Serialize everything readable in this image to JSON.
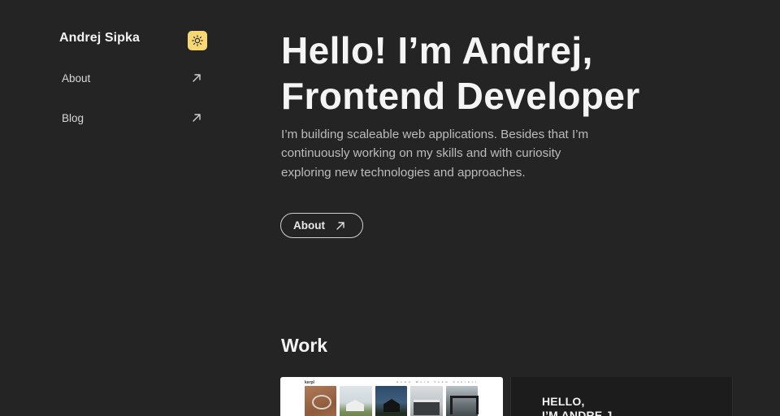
{
  "sidebar": {
    "brand": "Andrej Sipka",
    "nav": [
      {
        "label": "About"
      },
      {
        "label": "Blog"
      }
    ]
  },
  "colors": {
    "background": "#242424",
    "theme_toggle": "#f6d774"
  },
  "icons": {
    "theme_toggle": "sun-icon",
    "nav_link": "arrow-up-right-icon"
  },
  "hero": {
    "title_line1": "Hello! I’m Andrej,",
    "title_line2": "Frontend Developer",
    "description": "I’m building scaleable web applications. Besides that I’m continuously working on my skills and with curiosity exploring new technologies and approaches.",
    "button_label": "About"
  },
  "work": {
    "title": "Work",
    "projects": [
      {
        "logo_text": "kerpl",
        "menu_text": "Home Work Team Contact"
      },
      {
        "text_line1": "HELLO,",
        "text_line2": "I’M ANDRE J"
      }
    ]
  }
}
